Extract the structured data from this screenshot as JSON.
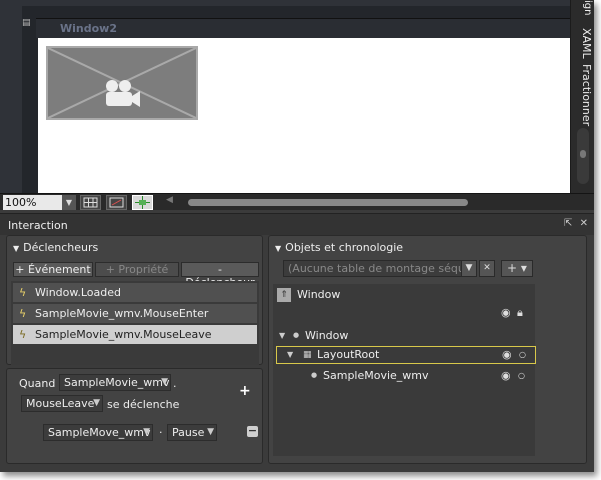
{
  "designer": {
    "window_title": "Window2",
    "side_tabs": [
      "XAML",
      "Fractionner"
    ],
    "top_tab_fragment": "ign",
    "zoom": "100%"
  },
  "interaction_panel": {
    "title": "Interaction"
  },
  "triggers": {
    "header": "Déclencheurs",
    "add_event_label": "+ Événement",
    "add_property_label": "+ Propriété",
    "remove_trigger_label": "- Déclencheur",
    "items": [
      "Window.Loaded",
      "SampleMovie_wmv.MouseEnter",
      "SampleMovie_wmv.MouseLeave"
    ]
  },
  "condition": {
    "when_label": "Quand",
    "source": "SampleMovie_wmv",
    "dot": ".",
    "event": "MouseLeave",
    "fires_label": "se déclenche",
    "action_target": "SampleMove_wmv",
    "action_dot": "·",
    "action": "Pause"
  },
  "objects": {
    "header": "Objets et chronologie",
    "storyboard_placeholder": "(Aucune table de montage séquentiel ouverte)",
    "scope": "Window",
    "tree": [
      "Window",
      "LayoutRoot",
      "SampleMovie_wmv"
    ]
  }
}
